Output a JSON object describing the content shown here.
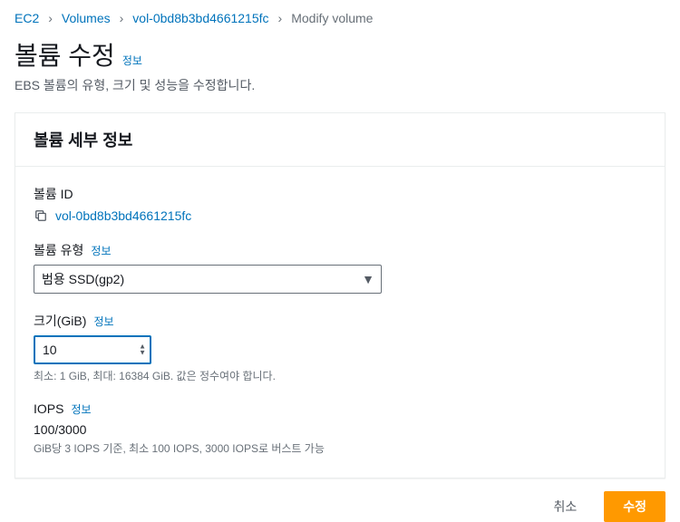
{
  "breadcrumb": {
    "items": [
      "EC2",
      "Volumes",
      "vol-0bd8b3bd4661215fc"
    ],
    "current": "Modify volume"
  },
  "header": {
    "title": "볼륨 수정",
    "info": "정보",
    "subtitle": "EBS 볼륨의 유형, 크기 및 성능을 수정합니다."
  },
  "panel": {
    "title": "볼륨 세부 정보",
    "volume_id": {
      "label": "볼륨 ID",
      "value": "vol-0bd8b3bd4661215fc"
    },
    "volume_type": {
      "label": "볼륨 유형",
      "info": "정보",
      "value": "범용 SSD(gp2)"
    },
    "size": {
      "label": "크기(GiB)",
      "info": "정보",
      "value": "10",
      "hint": "최소: 1 GiB, 최대: 16384 GiB. 값은 정수여야 합니다."
    },
    "iops": {
      "label": "IOPS",
      "info": "정보",
      "value": "100/3000",
      "hint": "GiB당 3 IOPS 기준, 최소 100 IOPS, 3000 IOPS로 버스트 가능"
    }
  },
  "footer": {
    "cancel": "취소",
    "submit": "수정"
  }
}
